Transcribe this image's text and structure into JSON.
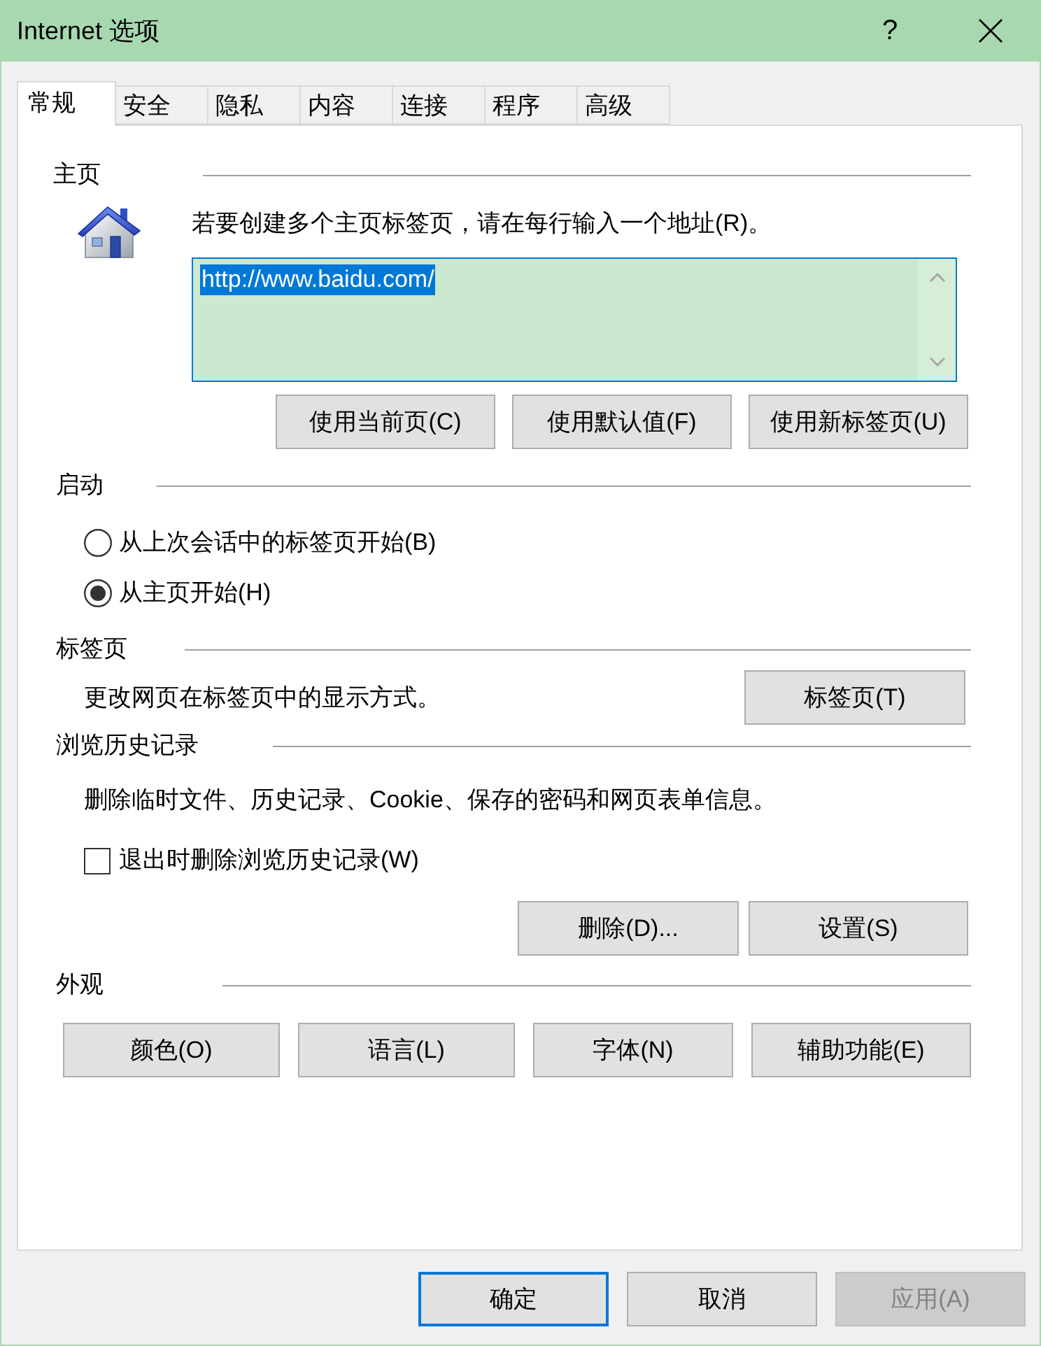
{
  "window": {
    "title": "Internet 选项",
    "help": "?"
  },
  "tabs": [
    {
      "label": "常规",
      "selected": true
    },
    {
      "label": "安全",
      "selected": false
    },
    {
      "label": "隐私",
      "selected": false
    },
    {
      "label": "内容",
      "selected": false
    },
    {
      "label": "连接",
      "selected": false
    },
    {
      "label": "程序",
      "selected": false
    },
    {
      "label": "高级",
      "selected": false
    }
  ],
  "home_page": {
    "heading": "主页",
    "instruction": "若要创建多个主页标签页，请在每行输入一个地址(R)。",
    "address": "http://www.baidu.com/",
    "address_selected": true,
    "buttons": [
      "使用当前页(C)",
      "使用默认值(F)",
      "使用新标签页(U)"
    ]
  },
  "startup": {
    "heading": "启动",
    "options": [
      {
        "label": "从上次会话中的标签页开始(B)",
        "selected": false
      },
      {
        "label": "从主页开始(H)",
        "selected": true
      }
    ]
  },
  "tabs_section": {
    "heading": "标签页",
    "description": "更改网页在标签页中的显示方式。",
    "button": "标签页(T)"
  },
  "browsing_history": {
    "heading": "浏览历史记录",
    "description": "删除临时文件、历史记录、Cookie、保存的密码和网页表单信息。",
    "delete_on_exit": {
      "label": "退出时删除浏览历史记录(W)",
      "checked": false
    },
    "buttons": [
      "删除(D)...",
      "设置(S)"
    ]
  },
  "appearance": {
    "heading": "外观",
    "buttons": [
      "颜色(O)",
      "语言(L)",
      "字体(N)",
      "辅助功能(E)"
    ]
  },
  "dialog_buttons": [
    {
      "label": "确定",
      "default": true,
      "disabled": false
    },
    {
      "label": "取消",
      "default": false,
      "disabled": false
    },
    {
      "label": "应用(A)",
      "default": false,
      "disabled": true
    }
  ]
}
